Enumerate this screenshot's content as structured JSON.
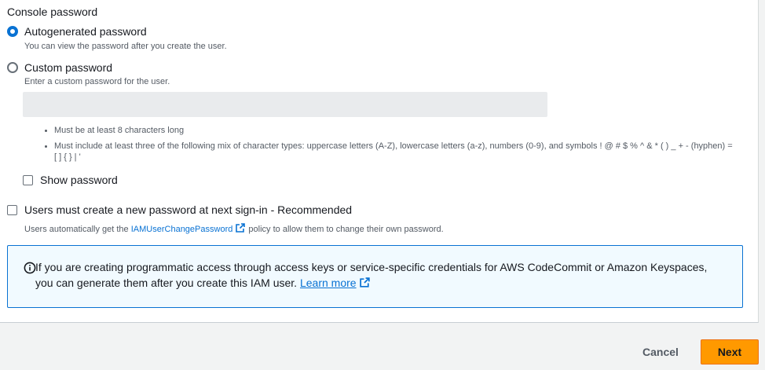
{
  "section": {
    "label": "Console password"
  },
  "password_options": {
    "autogenerated": {
      "label": "Autogenerated password",
      "description": "You can view the password after you create the user.",
      "checked": true
    },
    "custom": {
      "label": "Custom password",
      "description": "Enter a custom password for the user.",
      "checked": false,
      "input_value": "",
      "input_placeholder": ""
    }
  },
  "requirements": [
    "Must be at least 8 characters long",
    "Must include at least three of the following mix of character types: uppercase letters (A-Z), lowercase letters (a-z), numbers (0-9), and symbols ! @ # $ % ^ & * ( ) _ + - (hyphen) = [ ] { } | '"
  ],
  "show_password": {
    "label": "Show password",
    "checked": false
  },
  "reset_required": {
    "label": "Users must create a new password at next sign-in - Recommended",
    "checked": false,
    "desc_before": "Users automatically get the ",
    "link_text": "IAMUserChangePassword",
    "desc_after": " policy to allow them to change their own password."
  },
  "info": {
    "text": "If you are creating programmatic access through access keys or service-specific credentials for AWS CodeCommit or Amazon Keyspaces, you can generate them after you create this IAM user. ",
    "link_text": "Learn more"
  },
  "footer": {
    "cancel_label": "Cancel",
    "next_label": "Next"
  },
  "colors": {
    "accent": "#0972d3",
    "primary_button": "#ff9900",
    "info_background": "#f1faff"
  },
  "icons": {
    "info": "info-circle-icon",
    "external_link": "external-link-icon"
  }
}
